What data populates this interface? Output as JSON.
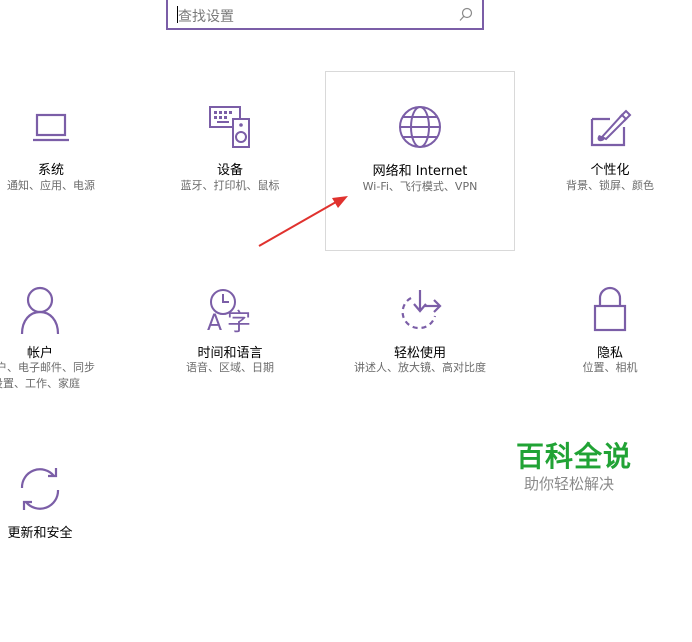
{
  "search": {
    "placeholder": "查找设置"
  },
  "tiles": [
    {
      "name": "系统",
      "desc": "通知、应用、电源"
    },
    {
      "name": "设备",
      "desc": "蓝牙、打印机、鼠标"
    },
    {
      "name": "网络和 Internet",
      "desc": "Wi-Fi、飞行模式、VPN"
    },
    {
      "name": "个性化",
      "desc": "背景、锁屏、颜色"
    },
    {
      "name": "帐户",
      "desc_line1": "账户、电子邮件、同步",
      "desc_line2": "设置、工作、家庭"
    },
    {
      "name": "时间和语言",
      "desc": "语音、区域、日期"
    },
    {
      "name": "轻松使用",
      "desc": "讲述人、放大镜、高对比度"
    },
    {
      "name": "隐私",
      "desc": "位置、相机"
    },
    {
      "name": "更新和安全"
    }
  ],
  "watermark": {
    "title": "百科全说",
    "subtitle": "助你轻松解决"
  },
  "colors": {
    "accent": "#7b5ea7",
    "arrow": "#e0322e",
    "watermark": "#21a335"
  }
}
